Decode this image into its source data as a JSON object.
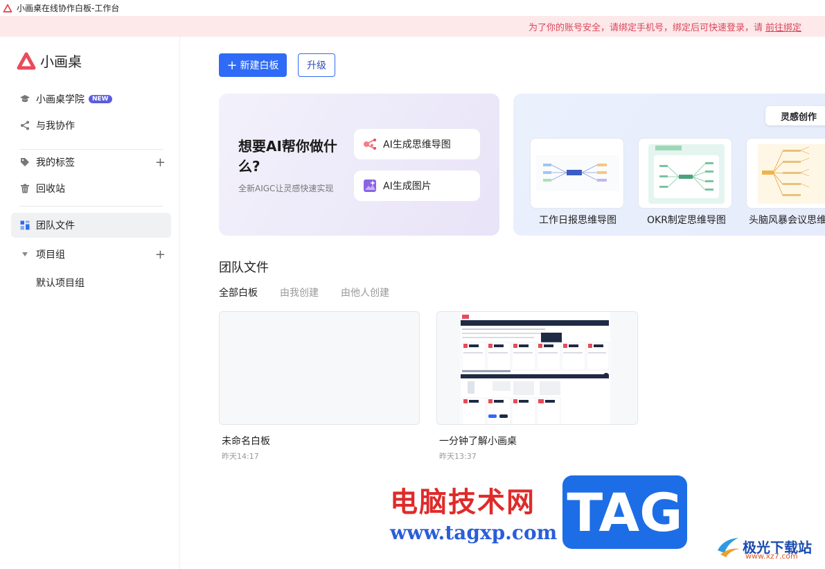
{
  "window": {
    "title": "小画桌在线协作白板-工作台"
  },
  "banner": {
    "message": "为了你的账号安全，请绑定手机号，绑定后可快速登录，请",
    "link": "前往绑定"
  },
  "brand": {
    "name": "小画桌",
    "color": "#e84b5a"
  },
  "sidebar": {
    "academy": {
      "label": "小画桌学院",
      "badge": "NEW",
      "icon": "graduation-cap-icon"
    },
    "collab": {
      "label": "与我协作",
      "icon": "share-icon"
    },
    "tags": {
      "label": "我的标签",
      "add": "+",
      "icon": "tag-icon"
    },
    "trash": {
      "label": "回收站",
      "icon": "trash-icon"
    },
    "team": {
      "label": "团队文件",
      "icon": "grid-icon"
    },
    "project_group": {
      "label": "项目组",
      "add": "+",
      "icon": "caret-down-icon"
    },
    "default_project": {
      "label": "默认项目组"
    }
  },
  "toolbar": {
    "new_board": "新建白板",
    "new_board_plus": "+",
    "upgrade": "升级",
    "accent": "#2f6bf6"
  },
  "ai_card": {
    "title": "想要AI帮你做什么?",
    "subtitle": "全新AIGC让灵感快速实现",
    "mindmap": "AI生成思维导图",
    "image": "AI生成图片"
  },
  "inspiration": {
    "tag": "灵感创作",
    "templates": [
      {
        "name": "工作日报思维导图"
      },
      {
        "name": "OKR制定思维导图"
      },
      {
        "name": "头脑风暴会议思维"
      }
    ]
  },
  "section": {
    "title": "团队文件"
  },
  "tabs": [
    {
      "label": "全部白板"
    },
    {
      "label": "由我创建"
    },
    {
      "label": "由他人创建"
    }
  ],
  "files": [
    {
      "name": "未命名白板",
      "time": "昨天14:17"
    },
    {
      "name": "一分钟了解小画桌",
      "time": "昨天13:37"
    }
  ],
  "watermark": {
    "site_cn": "电脑技术网",
    "site_url": "www.tagxp.com",
    "tag": "TAG",
    "brand2": "极光下载站",
    "brand2_url": "www.xz7.com"
  }
}
